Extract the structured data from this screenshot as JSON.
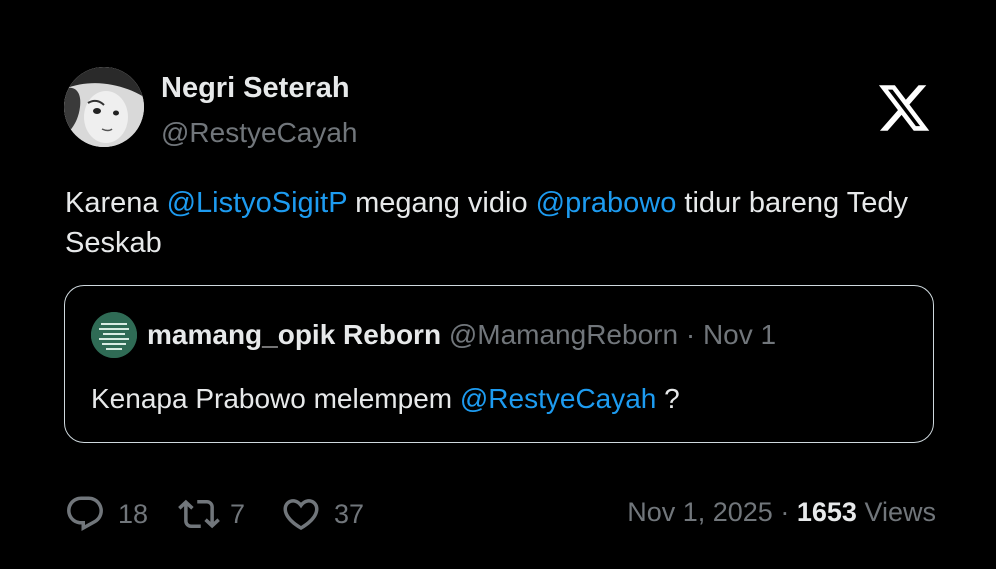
{
  "author": {
    "display_name": "Negri Seterah",
    "handle": "@RestyeCayah"
  },
  "brand": {
    "logo_icon": "x-logo-icon"
  },
  "tweet": {
    "text_1": "Karena ",
    "mention_1": "@ListyoSigitP",
    "text_2": " megang vidio ",
    "mention_2": "@prabowo",
    "text_3": " tidur bareng Tedy Seskab"
  },
  "quoted": {
    "display_name": "mamang_opik Reborn",
    "handle": "@MamangReborn",
    "separator": "·",
    "date": "Nov 1",
    "text_1": "Kenapa Prabowo melempem ",
    "mention": "@RestyeCayah",
    "text_2": " ?"
  },
  "metrics": {
    "replies": "18",
    "retweets": "7",
    "likes": "37"
  },
  "footer": {
    "date": "Nov 1, 2025",
    "separator": "·",
    "views_count": "1653",
    "views_label": "Views"
  },
  "colors": {
    "background": "#000000",
    "text": "#e7e9ea",
    "secondary": "#71767b",
    "mention": "#1d9bf0",
    "border": "#cfd9de"
  }
}
